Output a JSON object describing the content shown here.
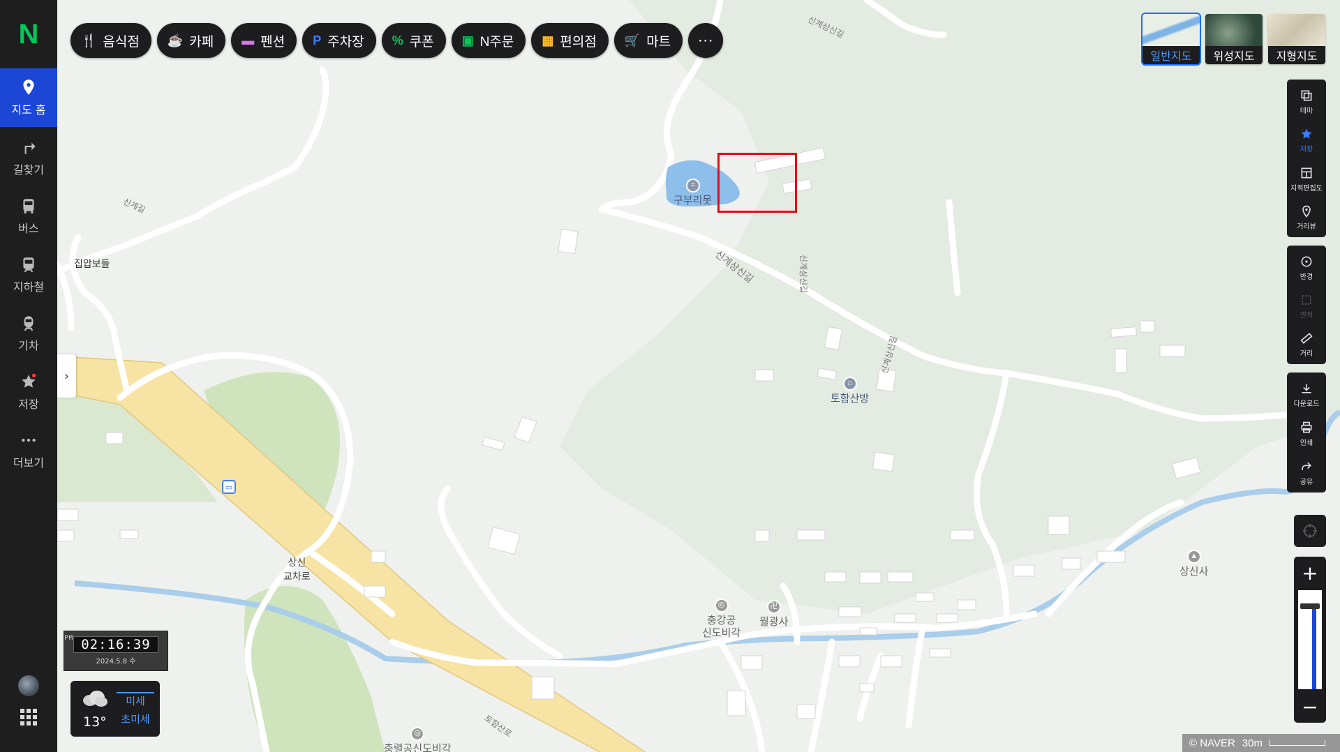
{
  "nav": {
    "logo": "N",
    "items": [
      {
        "label": "지도 홈",
        "icon": "map-pin-icon",
        "active": true
      },
      {
        "label": "길찾기",
        "icon": "directions-icon"
      },
      {
        "label": "버스",
        "icon": "bus-icon"
      },
      {
        "label": "지하철",
        "icon": "subway-icon"
      },
      {
        "label": "기차",
        "icon": "train-icon"
      },
      {
        "label": "저장",
        "icon": "star-icon"
      },
      {
        "label": "더보기",
        "icon": "more-icon"
      }
    ]
  },
  "categories": [
    {
      "label": "음식점",
      "icon": "restaurant-icon",
      "color": "#ff8a3d"
    },
    {
      "label": "카페",
      "icon": "cafe-icon",
      "color": "#ff8a3d"
    },
    {
      "label": "펜션",
      "icon": "bed-icon",
      "color": "#d977e8"
    },
    {
      "label": "주차장",
      "icon": "parking-icon",
      "color": "#3d7dff"
    },
    {
      "label": "쿠폰",
      "icon": "coupon-icon",
      "color": "#03c75a"
    },
    {
      "label": "N주문",
      "icon": "order-icon",
      "color": "#03c75a"
    },
    {
      "label": "편의점",
      "icon": "store-icon",
      "color": "#ffc12e"
    },
    {
      "label": "마트",
      "icon": "cart-icon",
      "color": "#ffc12e"
    }
  ],
  "more_label": "⋯",
  "map_types": [
    {
      "label": "일반지도",
      "selected": true
    },
    {
      "label": "위성지도"
    },
    {
      "label": "지형지도"
    }
  ],
  "tools": {
    "group1": [
      {
        "label": "테마",
        "icon": "layers-icon"
      },
      {
        "label": "저장",
        "icon": "star-icon",
        "active": true
      },
      {
        "label": "지적편집도",
        "icon": "cadastral-icon"
      },
      {
        "label": "거리뷰",
        "icon": "streetview-icon"
      }
    ],
    "group2": [
      {
        "label": "반경",
        "icon": "radius-icon"
      },
      {
        "label": "면적",
        "icon": "area-icon",
        "disabled": true
      },
      {
        "label": "거리",
        "icon": "ruler-icon"
      }
    ],
    "group3": [
      {
        "label": "다운로드",
        "icon": "download-icon"
      },
      {
        "label": "인쇄",
        "icon": "print-icon"
      },
      {
        "label": "공유",
        "icon": "share-icon"
      }
    ]
  },
  "zoom": {
    "plus": "+",
    "minus": "−",
    "level_fraction": 0.16
  },
  "clock": {
    "ampm": "PM",
    "time": "02:16:39",
    "date": "2024.5.8 수"
  },
  "weather": {
    "temp": "13°",
    "dust": "미세",
    "ultrafine_dust": "초미세"
  },
  "map": {
    "places": {
      "pond": "구부리못",
      "tohap": "토함산방",
      "memorial": "충강공\n신도비각",
      "temple": "월광사",
      "sangsinsa": "상신사",
      "jibap": "집압보들",
      "interchange": "상신\n교차로",
      "bottom_poi": "충렬공신도비각"
    },
    "roads": {
      "singye1": "신계길",
      "singye2": "신계상신길",
      "singye3": "신계상신길",
      "vertical1": "신계상신길",
      "vertical2": "신계상신길",
      "tohap_road": "토함산로"
    }
  },
  "scale": {
    "copyright": "© NAVER",
    "distance": "30m"
  }
}
